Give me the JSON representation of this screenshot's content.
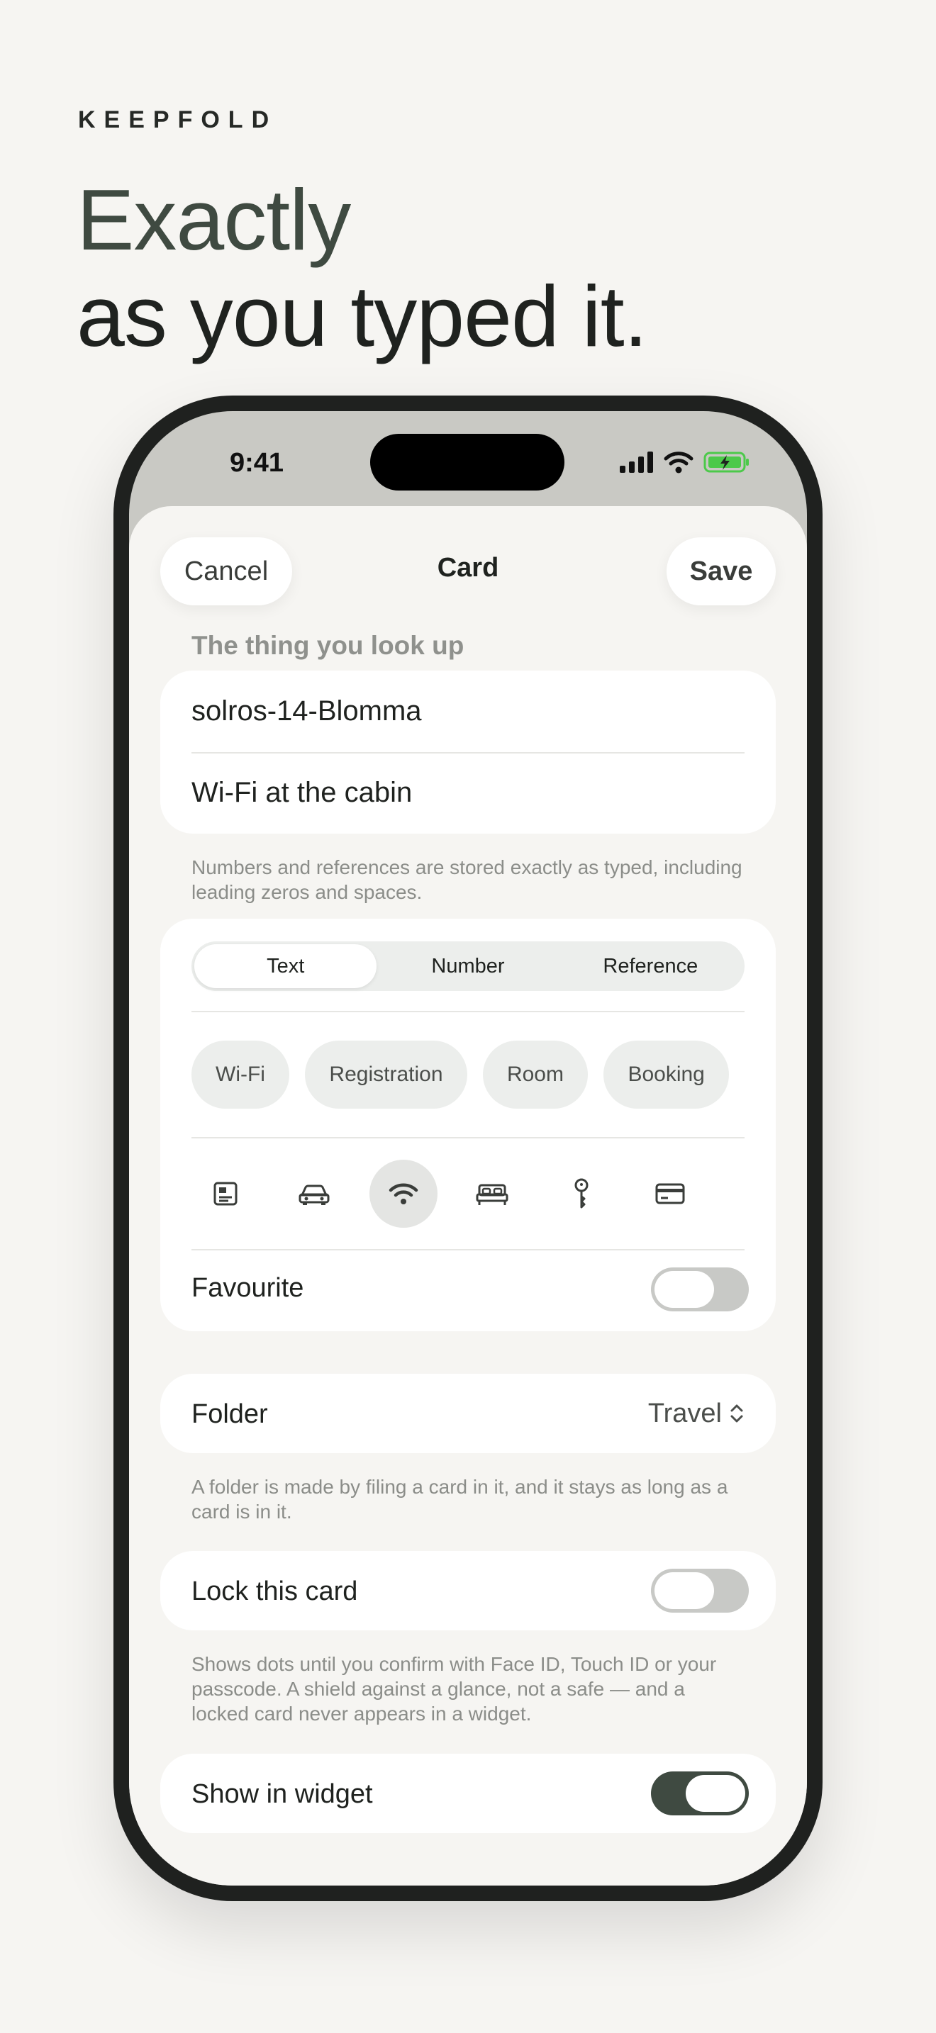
{
  "brand": "KEEPFOLD",
  "headline": {
    "line1": "Exactly",
    "line2": "as you typed it."
  },
  "status_bar": {
    "time": "9:41"
  },
  "nav": {
    "cancel": "Cancel",
    "title": "Card",
    "save": "Save"
  },
  "main_section": {
    "label": "The thing you look up",
    "value": "solros-14-Blomma",
    "title": "Wi-Fi at the cabin",
    "hint": "Numbers and references are stored exactly as typed, including leading zeros and spaces."
  },
  "type_segment": {
    "options": [
      "Text",
      "Number",
      "Reference"
    ],
    "selected": "Text"
  },
  "category_chips": [
    "Wi-Fi",
    "Registration",
    "Room",
    "Booking"
  ],
  "icon_choices": [
    "id-card-icon",
    "car-icon",
    "wifi-icon",
    "bed-icon",
    "key-icon",
    "credit-card-icon",
    "ticket-icon"
  ],
  "selected_icon": "wifi-icon",
  "favourite": {
    "label": "Favourite",
    "on": false
  },
  "folder": {
    "label": "Folder",
    "value": "Travel",
    "hint": "A folder is made by filing a card in it, and it stays as long as a card is in it."
  },
  "lock": {
    "label": "Lock this card",
    "on": false,
    "hint": "Shows dots until you confirm with Face ID, Touch ID or your passcode. A shield against a glance, not a safe — and a locked card never appears in a widget."
  },
  "widget": {
    "label": "Show in widget",
    "on": true
  },
  "colors": {
    "accent": "#3f4a41",
    "background": "#f6f5f2",
    "battery": "#4cc94a"
  }
}
